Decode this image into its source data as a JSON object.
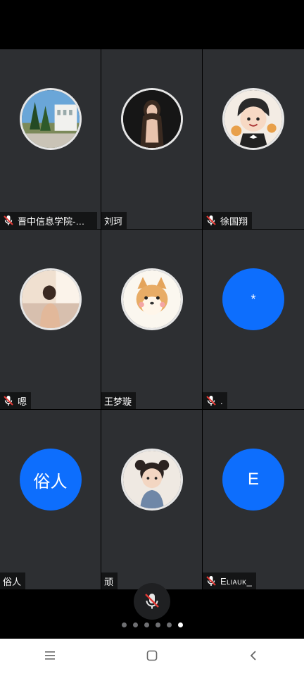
{
  "participants": [
    {
      "name": "晋中信息学院-尚…",
      "muted": true,
      "avatar": "campus-photo-avatar"
    },
    {
      "name": "刘珂",
      "muted": false,
      "avatar": "portrait-photo-avatar"
    },
    {
      "name": "徐国翔",
      "muted": true,
      "avatar": "cartoon-boy-avatar"
    },
    {
      "name": "嗯",
      "muted": true,
      "avatar": "window-girl-photo-avatar"
    },
    {
      "name": "王梦璇",
      "muted": false,
      "avatar": "shiba-dog-avatar"
    },
    {
      "name": ".",
      "muted": true,
      "avatar_text": "*"
    },
    {
      "name": "俗人",
      "muted": false,
      "avatar_text": "俗人"
    },
    {
      "name": "顽",
      "muted": false,
      "avatar": "child-photo-avatar"
    },
    {
      "name": "Eliauk_",
      "muted": true,
      "avatar_text": "E"
    }
  ],
  "pager": {
    "count": 6,
    "active": 6
  },
  "colors": {
    "tile_bg": "#2d2f32",
    "letter_avatar": "#0d6efd",
    "muted_red": "#e53935"
  },
  "icons": {
    "mic_button": "mic-muted-icon",
    "nav": [
      "menu-icon",
      "home-square-icon",
      "back-chevron-icon"
    ]
  }
}
